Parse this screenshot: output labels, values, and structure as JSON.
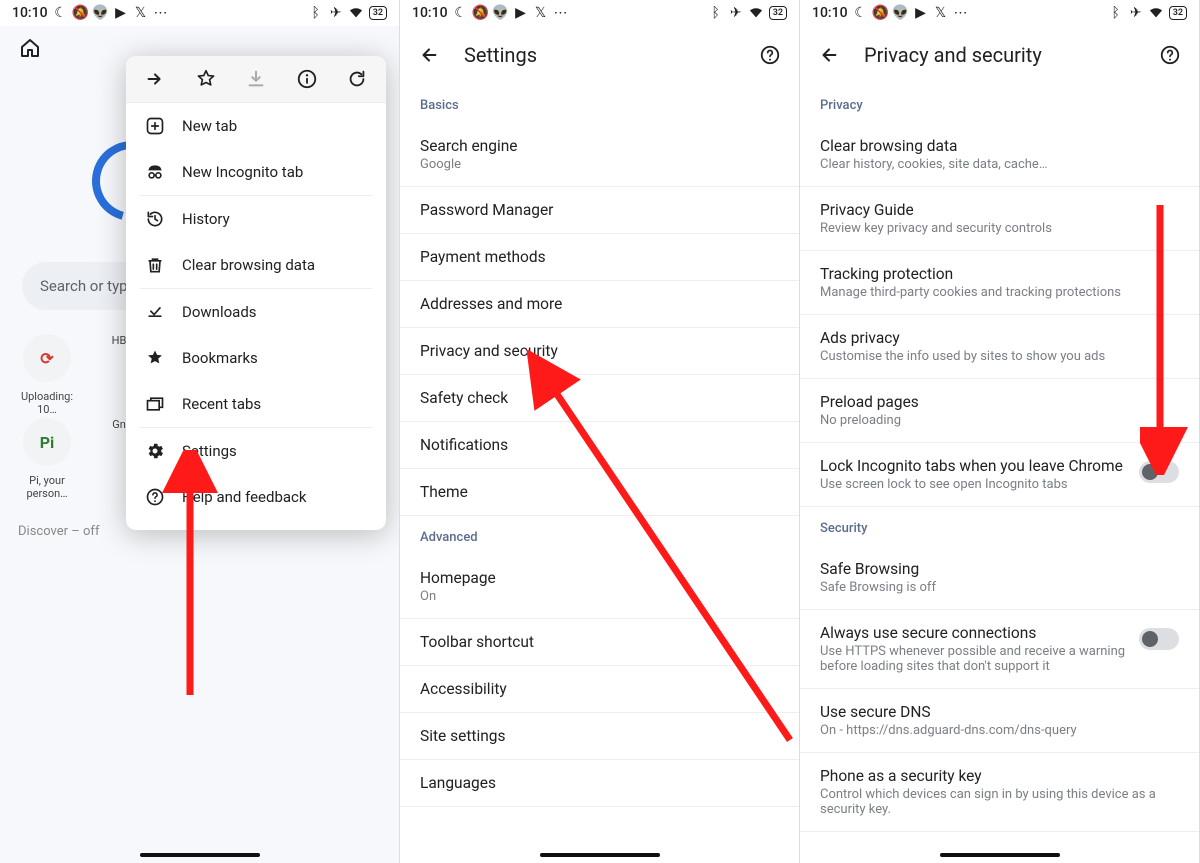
{
  "statusbar": {
    "time": "10:10",
    "battery": "32"
  },
  "screen1": {
    "search_placeholder": "Search or type URL",
    "chips": [
      {
        "label": "Uploading: 10…",
        "glyph": "⟳"
      },
      {
        "label": "HB",
        "glyph": ""
      },
      {
        "label": "Pi, your person…",
        "glyph": "Pi"
      },
      {
        "label": "Gn",
        "glyph": ""
      }
    ],
    "discover": "Discover – off",
    "menu": {
      "items": [
        {
          "icon": "plus-box-icon",
          "label": "New tab"
        },
        {
          "icon": "incognito-icon",
          "label": "New Incognito tab"
        },
        {
          "divider": true
        },
        {
          "icon": "history-icon",
          "label": "History"
        },
        {
          "icon": "trash-icon",
          "label": "Clear browsing data"
        },
        {
          "divider": true
        },
        {
          "icon": "download-check-icon",
          "label": "Downloads"
        },
        {
          "icon": "star-filled-icon",
          "label": "Bookmarks"
        },
        {
          "icon": "tabs-icon",
          "label": "Recent tabs"
        },
        {
          "divider": true
        },
        {
          "icon": "gear-icon",
          "label": "Settings"
        },
        {
          "icon": "help-circle-icon",
          "label": "Help and feedback"
        }
      ]
    }
  },
  "screen2": {
    "title": "Settings",
    "section_basics": "Basics",
    "section_advanced": "Advanced",
    "items_basics": [
      {
        "title": "Search engine",
        "sub": "Google"
      },
      {
        "title": "Password Manager"
      },
      {
        "title": "Payment methods"
      },
      {
        "title": "Addresses and more"
      },
      {
        "title": "Privacy and security"
      },
      {
        "title": "Safety check"
      },
      {
        "title": "Notifications"
      },
      {
        "title": "Theme"
      }
    ],
    "items_advanced": [
      {
        "title": "Homepage",
        "sub": "On"
      },
      {
        "title": "Toolbar shortcut"
      },
      {
        "title": "Accessibility"
      },
      {
        "title": "Site settings"
      },
      {
        "title": "Languages"
      }
    ]
  },
  "screen3": {
    "title": "Privacy and security",
    "section_privacy": "Privacy",
    "section_security": "Security",
    "privacy_items": [
      {
        "title": "Clear browsing data",
        "sub": "Clear history, cookies, site data, cache…"
      },
      {
        "title": "Privacy Guide",
        "sub": "Review key privacy and security controls"
      },
      {
        "title": "Tracking protection",
        "sub": "Manage third-party cookies and tracking protections"
      },
      {
        "title": "Ads privacy",
        "sub": "Customise the info used by sites to show you ads"
      },
      {
        "title": "Preload pages",
        "sub": "No preloading"
      },
      {
        "title": "Lock Incognito tabs when you leave Chrome",
        "sub": "Use screen lock to see open Incognito tabs",
        "toggle": true
      }
    ],
    "security_items": [
      {
        "title": "Safe Browsing",
        "sub": "Safe Browsing is off"
      },
      {
        "title": "Always use secure connections",
        "sub": "Use HTTPS whenever possible and receive a warning before loading sites that don't support it",
        "toggle": true
      },
      {
        "title": "Use secure DNS",
        "sub": "On - https://dns.adguard-dns.com/dns-query"
      },
      {
        "title": "Phone as a security key",
        "sub": "Control which devices can sign in by using this device as a security key."
      }
    ]
  }
}
